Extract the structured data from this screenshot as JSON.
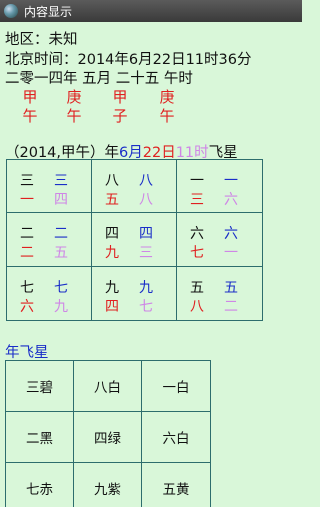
{
  "titlebar": {
    "title": "内容显示",
    "icon": "globe-icon"
  },
  "info": {
    "location": "地区：未知",
    "beijing_time": "北京时间：2014年6月22日11时36分",
    "lunar_date": "二零一四年 五月 二十五 午时"
  },
  "pillars": {
    "stems": [
      "甲",
      "庚",
      "甲",
      "庚"
    ],
    "branches": [
      "午",
      "午",
      "子",
      "午"
    ]
  },
  "flying_star_title": {
    "open": "（",
    "year_info": "2014,甲午",
    "close_year": "）年",
    "month": "6月",
    "day": "22日",
    "hour": "11时",
    "suffix": "飞星"
  },
  "month_grid": [
    [
      "三",
      "三",
      "一",
      "四"
    ],
    [
      "八",
      "八",
      "五",
      "八"
    ],
    [
      "一",
      "一",
      "三",
      "六"
    ],
    [
      "二",
      "二",
      "二",
      "五"
    ],
    [
      "四",
      "四",
      "九",
      "三"
    ],
    [
      "六",
      "六",
      "七",
      "一"
    ],
    [
      "七",
      "七",
      "六",
      "九"
    ],
    [
      "九",
      "九",
      "四",
      "七"
    ],
    [
      "五",
      "五",
      "八",
      "二"
    ]
  ],
  "year_section": {
    "title": "年飞星",
    "cells": [
      "三碧",
      "八白",
      "一白",
      "二黑",
      "四绿",
      "六白",
      "七赤",
      "九紫",
      "五黄"
    ]
  },
  "colors": {
    "stem_branch": "#e02020",
    "blue": "#1a2ec8",
    "pink": "#cf86e6",
    "border": "#2d6d6d",
    "background": "#d9f7d9"
  }
}
